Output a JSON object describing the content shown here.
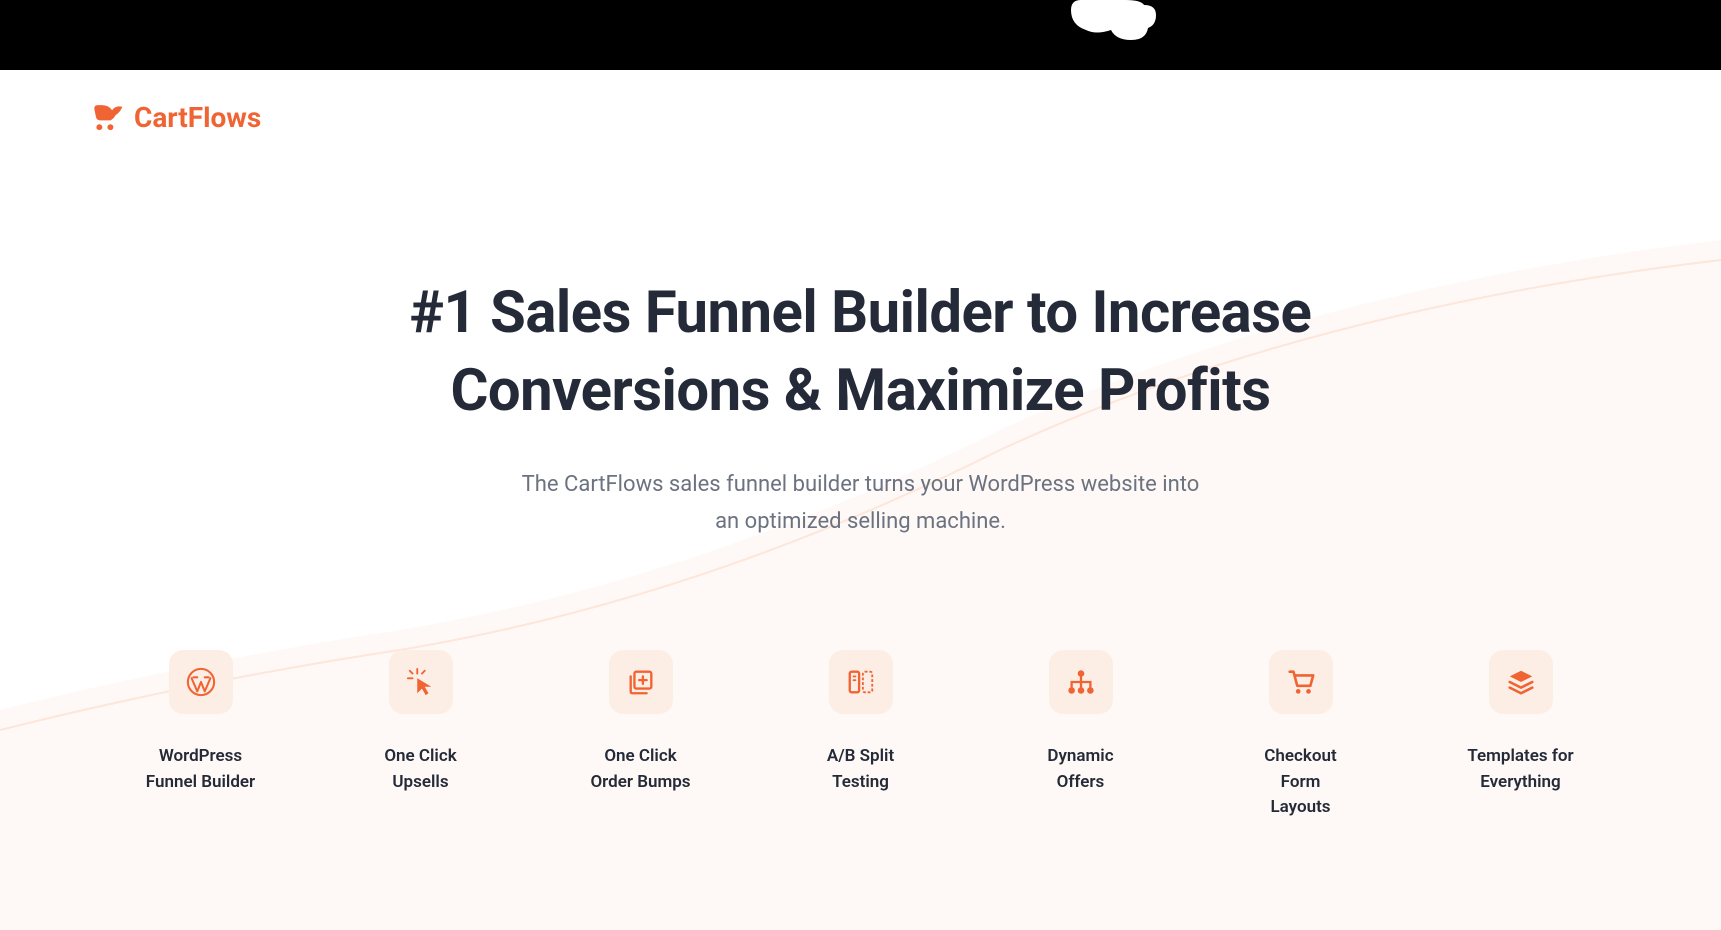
{
  "brand": {
    "name": "CartFlows",
    "accent": "#f06434"
  },
  "hero": {
    "title": "#1 Sales Funnel Builder to Increase Conversions & Maximize Profits",
    "subtitle": "The CartFlows sales funnel builder turns your WordPress website into an optimized selling machine."
  },
  "features": [
    {
      "label": "WordPress\nFunnel Builder",
      "icon": "wordpress-icon"
    },
    {
      "label": "One Click\nUpsells",
      "icon": "cursor-click-icon"
    },
    {
      "label": "One Click\nOrder Bumps",
      "icon": "add-page-icon"
    },
    {
      "label": "A/B Split\nTesting",
      "icon": "split-test-icon"
    },
    {
      "label": "Dynamic\nOffers",
      "icon": "sitemap-icon"
    },
    {
      "label": "Checkout Form\nLayouts",
      "icon": "cart-icon"
    },
    {
      "label": "Templates for\nEverything",
      "icon": "layers-icon"
    }
  ]
}
